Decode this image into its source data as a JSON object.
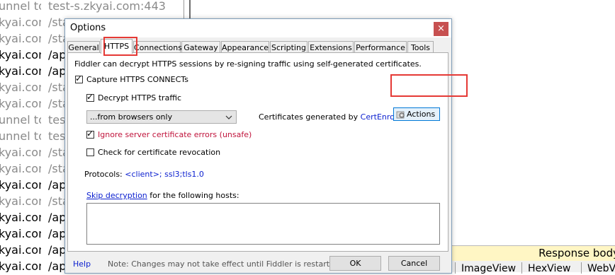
{
  "background": {
    "rows": [
      {
        "host": "unnel to",
        "url": "test-s.zkyai.com:443",
        "tone": "gray"
      },
      {
        "host": "kyai.com",
        "url": "/sta",
        "tone": "gray"
      },
      {
        "host": "kyai.com",
        "url": "/sta",
        "tone": "gray"
      },
      {
        "host": "kyai.com",
        "url": "/ap",
        "tone": "black"
      },
      {
        "host": "kyai.com",
        "url": "/ap",
        "tone": "black"
      },
      {
        "host": "kyai.com",
        "url": "/sta",
        "tone": "gray"
      },
      {
        "host": "kyai.com",
        "url": "/sta",
        "tone": "gray"
      },
      {
        "host": "unnel to",
        "url": "test",
        "tone": "gray"
      },
      {
        "host": "unnel to",
        "url": "test",
        "tone": "gray"
      },
      {
        "host": "kyai.com",
        "url": "/sta",
        "tone": "gray"
      },
      {
        "host": "kyai.com",
        "url": "/sta",
        "tone": "gray"
      },
      {
        "host": "kyai.com",
        "url": "/ap",
        "tone": "black"
      },
      {
        "host": "kyai.com",
        "url": "/sta",
        "tone": "gray"
      },
      {
        "host": "kyai.com",
        "url": "/ap",
        "tone": "black"
      },
      {
        "host": "kyai.com",
        "url": "/ap",
        "tone": "black"
      },
      {
        "host": "kyai.com",
        "url": "/ap",
        "tone": "black"
      },
      {
        "host": "kyai.com",
        "url": "/ap",
        "tone": "black"
      }
    ],
    "response_bar_label": "Response body",
    "response_tabs": [
      "ImageView",
      "HexView",
      "WebV"
    ]
  },
  "dialog": {
    "title": "Options",
    "close_glyph": "×",
    "tabs": [
      "General",
      "HTTPS",
      "Connections",
      "Gateway",
      "Appearance",
      "Scripting",
      "Extensions",
      "Performance",
      "Tools"
    ],
    "active_tab": "HTTPS",
    "https": {
      "intro": "Fiddler can decrypt HTTPS sessions by re-signing traffic using self-generated certificates.",
      "capture_connects": {
        "label": "Capture HTTPS CONNECTs",
        "checked": true
      },
      "decrypt_traffic": {
        "label": "Decrypt HTTPS traffic",
        "checked": true
      },
      "source_select": {
        "value": "...from browsers only"
      },
      "cert_text": "Certificates generated by",
      "cert_engine": "CertEnroll engine",
      "actions_button": "Actions",
      "ignore_errors": {
        "label": "Ignore server certificate errors (unsafe)",
        "checked": true
      },
      "check_revocation": {
        "label": "Check for certificate revocation",
        "checked": false
      },
      "protocols_label": "Protocols:",
      "protocols_value": "<client>; ssl3;tls1.0",
      "skip_link": "Skip decryption",
      "skip_rest": "for the following hosts:",
      "hosts_value": ""
    },
    "footer": {
      "help": "Help",
      "note": "Note: Changes may not take effect until Fiddler is restarted.",
      "ok": "OK",
      "cancel": "Cancel"
    }
  },
  "colors": {
    "annotation": "#e53935",
    "link": "#0a1ecf",
    "warning_text": "#c0143c",
    "close_button": "#c75050",
    "response_bar": "#fff6c4"
  },
  "icons": {
    "close": "close-icon",
    "dropdown": "chevron-down-icon",
    "actions": "gear-icon",
    "check": "check-icon"
  }
}
